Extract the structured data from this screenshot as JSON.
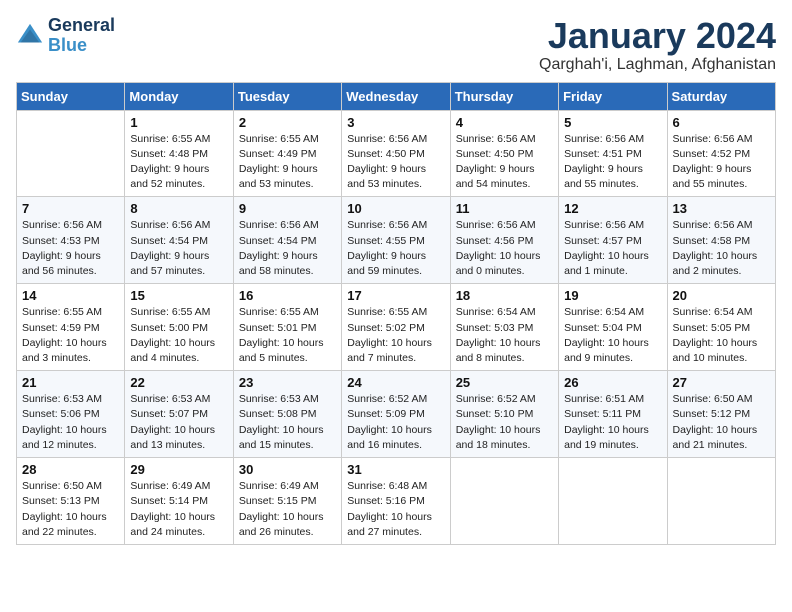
{
  "logo": {
    "line1": "General",
    "line2": "Blue"
  },
  "title": "January 2024",
  "subtitle": "Qarghah'i, Laghman, Afghanistan",
  "days_of_week": [
    "Sunday",
    "Monday",
    "Tuesday",
    "Wednesday",
    "Thursday",
    "Friday",
    "Saturday"
  ],
  "weeks": [
    [
      {
        "num": "",
        "sunrise": "",
        "sunset": "",
        "daylight": ""
      },
      {
        "num": "1",
        "sunrise": "Sunrise: 6:55 AM",
        "sunset": "Sunset: 4:48 PM",
        "daylight": "Daylight: 9 hours and 52 minutes."
      },
      {
        "num": "2",
        "sunrise": "Sunrise: 6:55 AM",
        "sunset": "Sunset: 4:49 PM",
        "daylight": "Daylight: 9 hours and 53 minutes."
      },
      {
        "num": "3",
        "sunrise": "Sunrise: 6:56 AM",
        "sunset": "Sunset: 4:50 PM",
        "daylight": "Daylight: 9 hours and 53 minutes."
      },
      {
        "num": "4",
        "sunrise": "Sunrise: 6:56 AM",
        "sunset": "Sunset: 4:50 PM",
        "daylight": "Daylight: 9 hours and 54 minutes."
      },
      {
        "num": "5",
        "sunrise": "Sunrise: 6:56 AM",
        "sunset": "Sunset: 4:51 PM",
        "daylight": "Daylight: 9 hours and 55 minutes."
      },
      {
        "num": "6",
        "sunrise": "Sunrise: 6:56 AM",
        "sunset": "Sunset: 4:52 PM",
        "daylight": "Daylight: 9 hours and 55 minutes."
      }
    ],
    [
      {
        "num": "7",
        "sunrise": "Sunrise: 6:56 AM",
        "sunset": "Sunset: 4:53 PM",
        "daylight": "Daylight: 9 hours and 56 minutes."
      },
      {
        "num": "8",
        "sunrise": "Sunrise: 6:56 AM",
        "sunset": "Sunset: 4:54 PM",
        "daylight": "Daylight: 9 hours and 57 minutes."
      },
      {
        "num": "9",
        "sunrise": "Sunrise: 6:56 AM",
        "sunset": "Sunset: 4:54 PM",
        "daylight": "Daylight: 9 hours and 58 minutes."
      },
      {
        "num": "10",
        "sunrise": "Sunrise: 6:56 AM",
        "sunset": "Sunset: 4:55 PM",
        "daylight": "Daylight: 9 hours and 59 minutes."
      },
      {
        "num": "11",
        "sunrise": "Sunrise: 6:56 AM",
        "sunset": "Sunset: 4:56 PM",
        "daylight": "Daylight: 10 hours and 0 minutes."
      },
      {
        "num": "12",
        "sunrise": "Sunrise: 6:56 AM",
        "sunset": "Sunset: 4:57 PM",
        "daylight": "Daylight: 10 hours and 1 minute."
      },
      {
        "num": "13",
        "sunrise": "Sunrise: 6:56 AM",
        "sunset": "Sunset: 4:58 PM",
        "daylight": "Daylight: 10 hours and 2 minutes."
      }
    ],
    [
      {
        "num": "14",
        "sunrise": "Sunrise: 6:55 AM",
        "sunset": "Sunset: 4:59 PM",
        "daylight": "Daylight: 10 hours and 3 minutes."
      },
      {
        "num": "15",
        "sunrise": "Sunrise: 6:55 AM",
        "sunset": "Sunset: 5:00 PM",
        "daylight": "Daylight: 10 hours and 4 minutes."
      },
      {
        "num": "16",
        "sunrise": "Sunrise: 6:55 AM",
        "sunset": "Sunset: 5:01 PM",
        "daylight": "Daylight: 10 hours and 5 minutes."
      },
      {
        "num": "17",
        "sunrise": "Sunrise: 6:55 AM",
        "sunset": "Sunset: 5:02 PM",
        "daylight": "Daylight: 10 hours and 7 minutes."
      },
      {
        "num": "18",
        "sunrise": "Sunrise: 6:54 AM",
        "sunset": "Sunset: 5:03 PM",
        "daylight": "Daylight: 10 hours and 8 minutes."
      },
      {
        "num": "19",
        "sunrise": "Sunrise: 6:54 AM",
        "sunset": "Sunset: 5:04 PM",
        "daylight": "Daylight: 10 hours and 9 minutes."
      },
      {
        "num": "20",
        "sunrise": "Sunrise: 6:54 AM",
        "sunset": "Sunset: 5:05 PM",
        "daylight": "Daylight: 10 hours and 10 minutes."
      }
    ],
    [
      {
        "num": "21",
        "sunrise": "Sunrise: 6:53 AM",
        "sunset": "Sunset: 5:06 PM",
        "daylight": "Daylight: 10 hours and 12 minutes."
      },
      {
        "num": "22",
        "sunrise": "Sunrise: 6:53 AM",
        "sunset": "Sunset: 5:07 PM",
        "daylight": "Daylight: 10 hours and 13 minutes."
      },
      {
        "num": "23",
        "sunrise": "Sunrise: 6:53 AM",
        "sunset": "Sunset: 5:08 PM",
        "daylight": "Daylight: 10 hours and 15 minutes."
      },
      {
        "num": "24",
        "sunrise": "Sunrise: 6:52 AM",
        "sunset": "Sunset: 5:09 PM",
        "daylight": "Daylight: 10 hours and 16 minutes."
      },
      {
        "num": "25",
        "sunrise": "Sunrise: 6:52 AM",
        "sunset": "Sunset: 5:10 PM",
        "daylight": "Daylight: 10 hours and 18 minutes."
      },
      {
        "num": "26",
        "sunrise": "Sunrise: 6:51 AM",
        "sunset": "Sunset: 5:11 PM",
        "daylight": "Daylight: 10 hours and 19 minutes."
      },
      {
        "num": "27",
        "sunrise": "Sunrise: 6:50 AM",
        "sunset": "Sunset: 5:12 PM",
        "daylight": "Daylight: 10 hours and 21 minutes."
      }
    ],
    [
      {
        "num": "28",
        "sunrise": "Sunrise: 6:50 AM",
        "sunset": "Sunset: 5:13 PM",
        "daylight": "Daylight: 10 hours and 22 minutes."
      },
      {
        "num": "29",
        "sunrise": "Sunrise: 6:49 AM",
        "sunset": "Sunset: 5:14 PM",
        "daylight": "Daylight: 10 hours and 24 minutes."
      },
      {
        "num": "30",
        "sunrise": "Sunrise: 6:49 AM",
        "sunset": "Sunset: 5:15 PM",
        "daylight": "Daylight: 10 hours and 26 minutes."
      },
      {
        "num": "31",
        "sunrise": "Sunrise: 6:48 AM",
        "sunset": "Sunset: 5:16 PM",
        "daylight": "Daylight: 10 hours and 27 minutes."
      },
      {
        "num": "",
        "sunrise": "",
        "sunset": "",
        "daylight": ""
      },
      {
        "num": "",
        "sunrise": "",
        "sunset": "",
        "daylight": ""
      },
      {
        "num": "",
        "sunrise": "",
        "sunset": "",
        "daylight": ""
      }
    ]
  ]
}
